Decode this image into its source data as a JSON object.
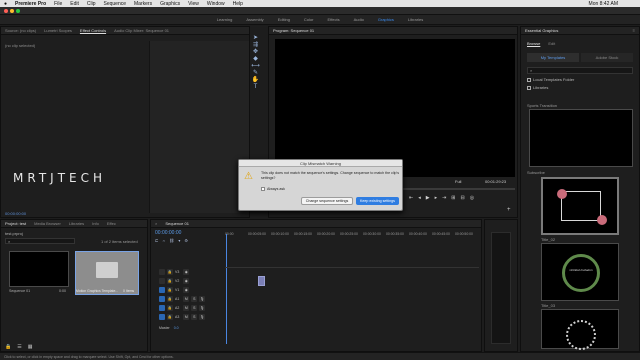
{
  "menubar": {
    "app": "Premiere Pro",
    "items": [
      "File",
      "Edit",
      "Clip",
      "Sequence",
      "Markers",
      "Graphics",
      "View",
      "Window",
      "Help"
    ],
    "clock": "Mon 8:42 AM"
  },
  "workspaces": [
    "Learning",
    "Assembly",
    "Editing",
    "Color",
    "Effects",
    "Audio",
    "Graphics",
    "Libraries"
  ],
  "workspace_active": "Graphics",
  "source_panel": {
    "tabs": [
      "Source: (no clips)",
      "Lumetri Scopes",
      "Effect Controls",
      "Audio Clip Mixer: Sequence 01"
    ],
    "active_tab": "Effect Controls",
    "content": "(no clip selected)",
    "watermark": "MRTJTECH",
    "time": "00:00:00:00"
  },
  "program_panel": {
    "title": "Program: Sequence 01",
    "fit": "Full",
    "timecode": "00:01:29:23"
  },
  "dialog": {
    "title": "Clip Mismatch Warning",
    "message": "This clip does not match the sequence's settings. Change sequence to match the clip's settings?",
    "checkbox": "Always ask",
    "change_button": "Change sequence settings",
    "keep_button": "Keep existing settings"
  },
  "project_panel": {
    "tabs": [
      "Project: test",
      "Media Browser",
      "Libraries",
      "Info",
      "Effec"
    ],
    "project_file": "test.prproj",
    "selection": "1 of 2 items selected",
    "items": [
      {
        "name": "Sequence 01",
        "duration": "0:00"
      },
      {
        "name": "Motion Graphics Template...",
        "duration": "0 Items"
      }
    ]
  },
  "timeline_panel": {
    "title": "Sequence 01",
    "timecode": "00:00:00:00",
    "ruler": [
      "00:00",
      "00:00:05:00",
      "00:00:10:00",
      "00:00:15:00",
      "00:00:20:00",
      "00:00:25:00",
      "00:00:30:00",
      "00:00:35:00",
      "00:00:40:00",
      "00:00:45:00",
      "00:00:50:00"
    ],
    "video_tracks": [
      "V3",
      "V2",
      "V1"
    ],
    "audio_tracks": [
      "A1",
      "A2",
      "A3"
    ],
    "master": "Master",
    "master_value": "0.0"
  },
  "essential_graphics": {
    "title": "Essential Graphics",
    "tabs": [
      "Browse",
      "Edit"
    ],
    "buttons": [
      "My Templates",
      "Adobe Stock"
    ],
    "search_placeholder": "",
    "checkbox": "Local Templates Folder",
    "library": "Libraries",
    "items": [
      "Sports Transition",
      "Subscribe",
      "Title_02",
      "Title_03"
    ],
    "thumb_texts": [
      "Untitled Invitation"
    ]
  },
  "status_text": "Click to select, or click in empty space and drag to marquee select. Use Shift, Opt, and Cmd for other options."
}
